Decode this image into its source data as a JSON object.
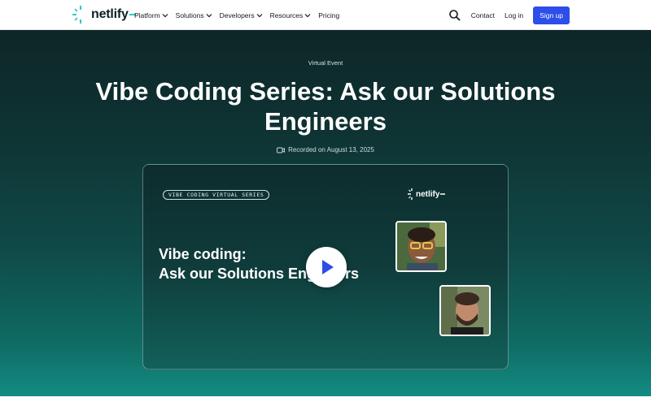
{
  "header": {
    "logo_text": "netlify",
    "nav": [
      {
        "label": "Platform",
        "has_menu": true
      },
      {
        "label": "Solutions",
        "has_menu": true
      },
      {
        "label": "Developers",
        "has_menu": true
      },
      {
        "label": "Resources",
        "has_menu": true
      },
      {
        "label": "Pricing",
        "has_menu": false
      }
    ],
    "contact_label": "Contact",
    "login_label": "Log in",
    "signup_label": "Sign up",
    "search_icon": "search-icon"
  },
  "hero": {
    "eyebrow": "Virtual Event",
    "title": "Vibe Coding Series: Ask our Solutions Engineers",
    "recorded": "Recorded on August 13, 2025",
    "recorded_icon": "video-camera-icon"
  },
  "video": {
    "series_label": "VIBE CODING VIRTUAL SERIES",
    "logo_text": "netlify",
    "title_line1": "Vibe coding:",
    "title_line2": "Ask our Solutions Engineers",
    "play_icon": "play-icon"
  },
  "colors": {
    "accent": "#2d4ee8",
    "logo_teal": "#30c8c9",
    "hero_dark": "#0d2627",
    "hero_light": "#138c82",
    "play_blue": "#2d4ee8"
  }
}
